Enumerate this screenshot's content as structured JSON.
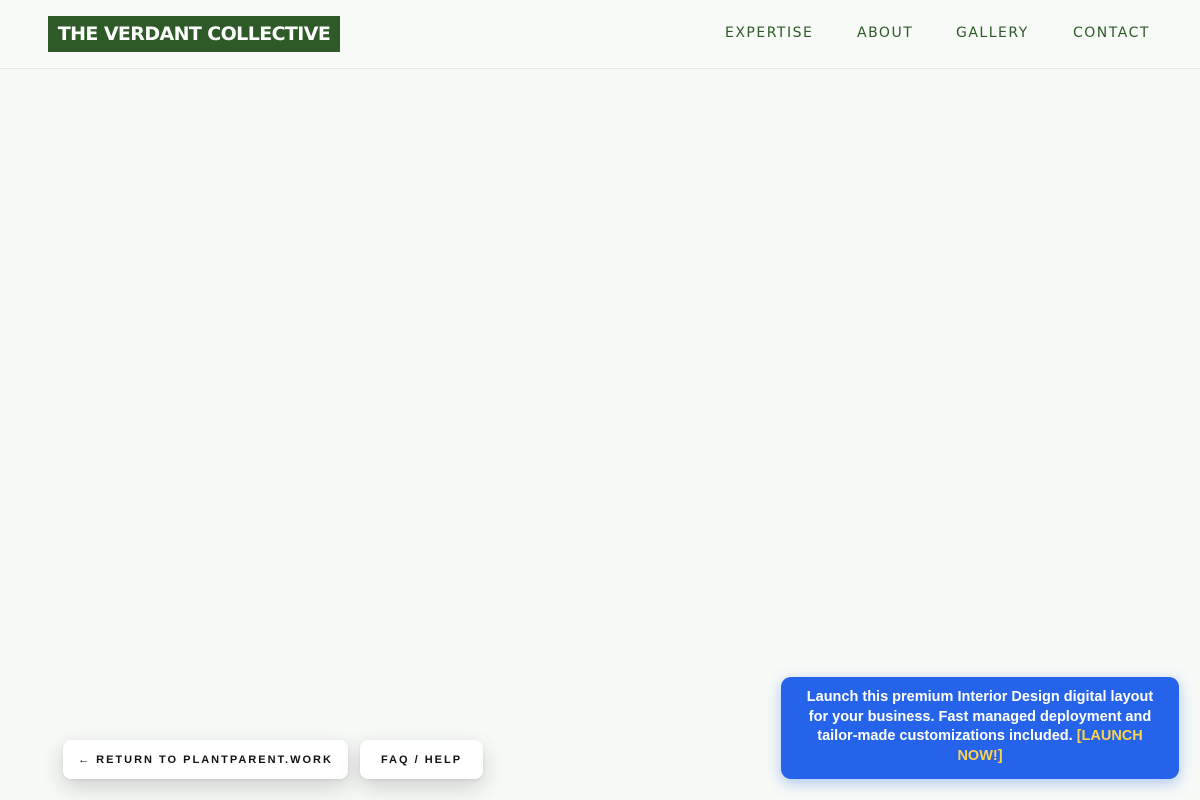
{
  "header": {
    "logo_text": "THE VERDANT COLLECTIVE",
    "nav": [
      {
        "label": "EXPERTISE"
      },
      {
        "label": "ABOUT"
      },
      {
        "label": "GALLERY"
      },
      {
        "label": "CONTACT"
      }
    ]
  },
  "footer_actions": {
    "return_label": "← RETURN TO PLANTPARENT.WORK",
    "faq_label": "FAQ / HELP"
  },
  "promo": {
    "text": "Launch this premium Interior Design digital layout for your business. Fast managed deployment and tailor-made customizations included.",
    "cta": "[LAUNCH NOW!]"
  },
  "colors": {
    "background": "#f6f9f6",
    "brand_green": "#2e5a27",
    "promo_blue": "#2563eb",
    "cta_yellow": "#fcd34d"
  }
}
